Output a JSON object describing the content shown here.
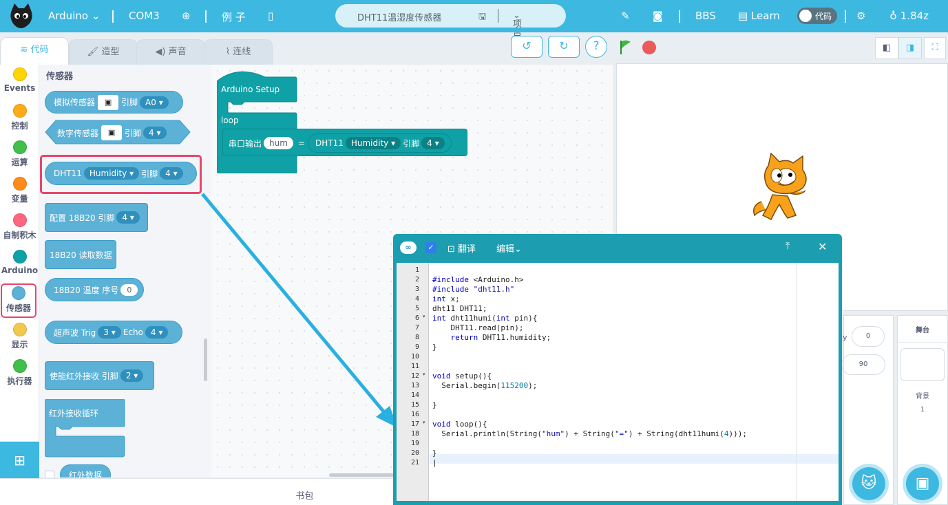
{
  "topbar": {
    "brand": "Arduino",
    "port": "COM3",
    "examples": "例 子",
    "project_name": "DHT11温湿度传感器",
    "project_menu": "项目",
    "bbs": "BBS",
    "learn": "Learn",
    "code_toggle": "代码",
    "version": "1.84z"
  },
  "tabs": {
    "code": "代码",
    "costume": "造型",
    "sound": "声音",
    "wiring": "连线"
  },
  "categories": [
    {
      "label": "Events",
      "color": "#ffd500"
    },
    {
      "label": "控制",
      "color": "#ffab19"
    },
    {
      "label": "运算",
      "color": "#40bf4a"
    },
    {
      "label": "变量",
      "color": "#ff8c1a"
    },
    {
      "label": "自制积木",
      "color": "#ff6680"
    },
    {
      "label": "Arduino",
      "color": "#0fa1a5"
    },
    {
      "label": "传感器",
      "color": "#5cb1d6"
    },
    {
      "label": "显示",
      "color": "#f2c94c"
    },
    {
      "label": "执行器",
      "color": "#40bf4a"
    }
  ],
  "palette": {
    "section_title": "传感器",
    "analog": {
      "label": "模拟传感器",
      "pin_label": "引脚",
      "pin": "A0"
    },
    "digital": {
      "label": "数字传感器",
      "pin_label": "引脚",
      "pin": "4"
    },
    "dht": {
      "label": "DHT11",
      "mode": "Humidity",
      "pin_label": "引脚",
      "pin": "4"
    },
    "ds_config": {
      "label": "配置 18B20 引脚",
      "pin": "4"
    },
    "ds_read": {
      "label": "18B20 读取数据"
    },
    "ds_temp": {
      "label": "18B20 温度 序号",
      "index": "0"
    },
    "ultrasonic": {
      "label": "超声波 Trig",
      "trig": "3",
      "echo_label": "Echo",
      "echo": "4"
    },
    "ir_enable": {
      "label": "使能红外接收 引脚",
      "pin": "2"
    },
    "ir_loop": {
      "label": "红外接收循环"
    },
    "ir_data": {
      "label": "红外数据"
    }
  },
  "script": {
    "setup": "Arduino Setup",
    "loop": "loop",
    "serial_label": "串口输出",
    "key": "hum",
    "equals": "=",
    "dht_label": "DHT11",
    "dht_mode": "Humidity",
    "pin_label": "引脚",
    "pin": "4"
  },
  "editor": {
    "compile": "翻译",
    "edit": "编辑",
    "lines": [
      "1",
      "2",
      "3",
      "4",
      "5",
      "6",
      "7",
      "8",
      "9",
      "10",
      "11",
      "12",
      "13",
      "14",
      "15",
      "16",
      "17",
      "18",
      "19",
      "20",
      "21"
    ]
  },
  "sprite_info": {
    "y_label": "y",
    "y_value": "0",
    "direction": "90"
  },
  "stage_panel": {
    "title": "舞台",
    "backdrops_label": "背景",
    "backdrops_count": "1"
  },
  "bottom": {
    "backpack": "书包"
  }
}
